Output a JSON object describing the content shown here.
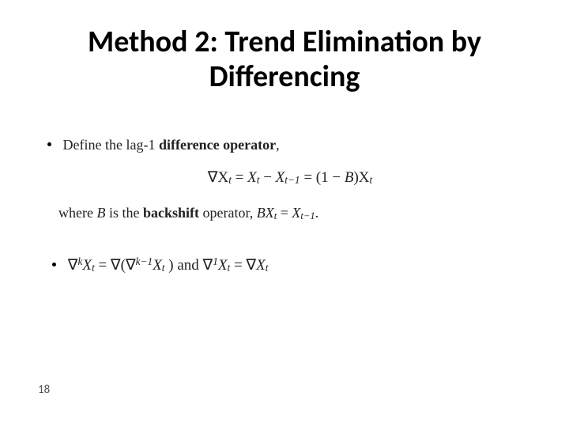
{
  "title_line1": "Method 2: Trend Elimination by",
  "title_line2": "Differencing",
  "intro_prefix": "Define the lag-1 ",
  "intro_bold": "difference operator",
  "intro_suffix": ",",
  "eq1_lhs": "∇X",
  "eq1_sub_t": "t",
  "eq1_eq": " = ",
  "eq1_rhs1": "X",
  "eq1_minus": " − ",
  "eq1_rhs2": "X",
  "eq1_sub_tm1": "t−1",
  "eq1_eq2": " = (1 − ",
  "eq1_B": "B",
  "eq1_close": ")X",
  "eq1_end_sub": "t",
  "where_prefix": "where ",
  "where_B": "B",
  "where_mid": " is the ",
  "where_bold": "backshift",
  "where_mid2": " operator, ",
  "where_eq_lhs": "BX",
  "where_eq_sub_t": "t",
  "where_eq_eq": " = ",
  "where_eq_rhs": "X",
  "where_eq_sub_tm1": "t−1",
  "where_period": ".",
  "eq2_nabla": "∇",
  "eq2_sup_k": "k",
  "eq2_X": "X",
  "eq2_sub_t": "t",
  "eq2_eq": " = ∇(∇",
  "eq2_sup_km1": "k−1",
  "eq2_X2": "X",
  "eq2_sub_t2": "t",
  "eq2_and": ") and ∇",
  "eq2_sup_1": "1",
  "eq2_X3": "X",
  "eq2_sub_t3": "t",
  "eq2_eq2": " = ∇",
  "eq2_X4": "X",
  "eq2_sub_t4": "t",
  "page_number": "18"
}
